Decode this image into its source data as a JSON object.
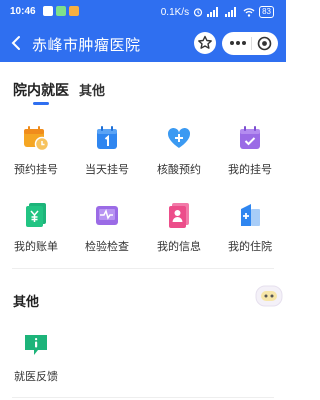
{
  "status_bar": {
    "time": "10:46",
    "net_speed": "0.1K/s",
    "battery": "83"
  },
  "nav": {
    "title": "赤峰市肿瘤医院"
  },
  "tabs": [
    {
      "label": "院内就医",
      "active": true
    },
    {
      "label": "其他",
      "active": false
    }
  ],
  "services": [
    {
      "label": "预约挂号",
      "icon": "calendar-clock-icon",
      "color": "#f5a623"
    },
    {
      "label": "当天挂号",
      "icon": "calendar-one-icon",
      "color": "#2f86f0"
    },
    {
      "label": "核酸预约",
      "icon": "heart-plus-icon",
      "color": "#3b9af2"
    },
    {
      "label": "我的挂号",
      "icon": "calendar-check-icon",
      "color": "#9b6be6"
    },
    {
      "label": "我的账单",
      "icon": "yuan-bill-icon",
      "color": "#1db47a"
    },
    {
      "label": "检验检查",
      "icon": "pulse-report-icon",
      "color": "#9b6be6"
    },
    {
      "label": "我的信息",
      "icon": "user-card-icon",
      "color": "#ec4e8a"
    },
    {
      "label": "我的住院",
      "icon": "hospital-building-icon",
      "color": "#2f86f0"
    }
  ],
  "other_section": {
    "title": "其他",
    "items": [
      {
        "label": "就医反馈",
        "icon": "chat-info-icon",
        "color": "#1db47a"
      }
    ]
  },
  "colors": {
    "primary": "#2f6ff0"
  }
}
